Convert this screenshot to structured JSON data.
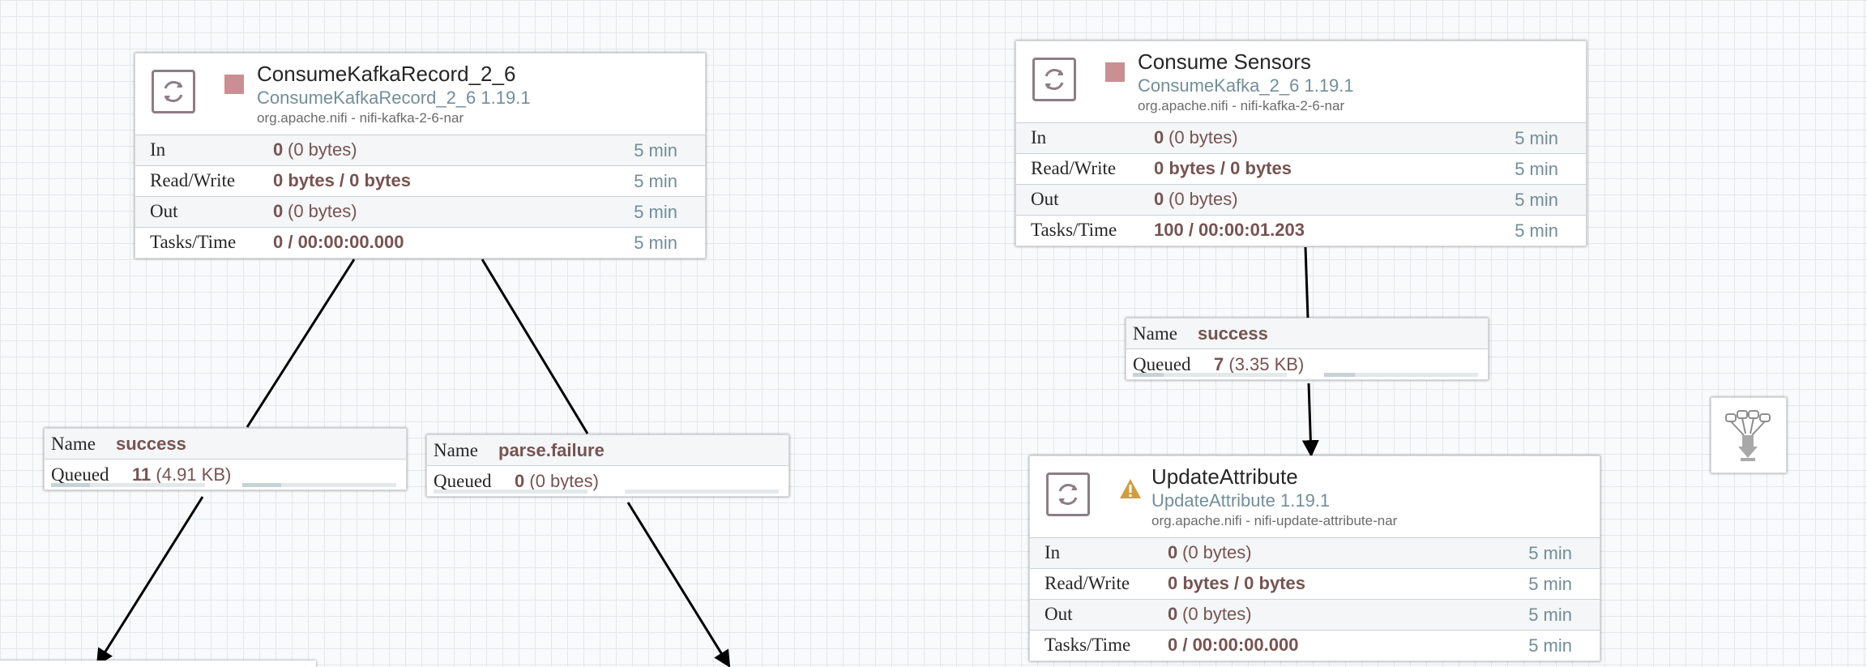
{
  "processors": [
    {
      "name": "ConsumeKafkaRecord_2_6",
      "type": "ConsumeKafkaRecord_2_6 1.19.1",
      "bundle": "org.apache.nifi - nifi-kafka-2-6-nar",
      "run_status": "stopped",
      "stats": {
        "in": {
          "label": "In",
          "count": "0",
          "size": "(0 bytes)",
          "time": "5 min"
        },
        "read_write": {
          "label": "Read/Write",
          "value": "0 bytes / 0 bytes",
          "time": "5 min"
        },
        "out": {
          "label": "Out",
          "count": "0",
          "size": "(0 bytes)",
          "time": "5 min"
        },
        "tasks": {
          "label": "Tasks/Time",
          "value": "0 / 00:00:00.000",
          "time": "5 min"
        }
      }
    },
    {
      "name": "Consume Sensors",
      "type": "ConsumeKafka_2_6 1.19.1",
      "bundle": "org.apache.nifi - nifi-kafka-2-6-nar",
      "run_status": "stopped",
      "stats": {
        "in": {
          "label": "In",
          "count": "0",
          "size": "(0 bytes)",
          "time": "5 min"
        },
        "read_write": {
          "label": "Read/Write",
          "value": "0 bytes / 0 bytes",
          "time": "5 min"
        },
        "out": {
          "label": "Out",
          "count": "0",
          "size": "(0 bytes)",
          "time": "5 min"
        },
        "tasks": {
          "label": "Tasks/Time",
          "value": "100 / 00:00:01.203",
          "time": "5 min"
        }
      }
    },
    {
      "name": "UpdateAttribute",
      "type": "UpdateAttribute 1.19.1",
      "bundle": "org.apache.nifi - nifi-update-attribute-nar",
      "run_status": "invalid",
      "stats": {
        "in": {
          "label": "In",
          "count": "0",
          "size": "(0 bytes)",
          "time": "5 min"
        },
        "read_write": {
          "label": "Read/Write",
          "value": "0 bytes / 0 bytes",
          "time": "5 min"
        },
        "out": {
          "label": "Out",
          "count": "0",
          "size": "(0 bytes)",
          "time": "5 min"
        },
        "tasks": {
          "label": "Tasks/Time",
          "value": "0 / 00:00:00.000",
          "time": "5 min"
        }
      }
    }
  ],
  "connections": [
    {
      "name_label": "Name",
      "name": "success",
      "queued_label": "Queued",
      "count": "11",
      "size": "(4.91 KB)",
      "fill": 0.25
    },
    {
      "name_label": "Name",
      "name": "parse.failure",
      "queued_label": "Queued",
      "count": "0",
      "size": "(0 bytes)",
      "fill": 0
    },
    {
      "name_label": "Name",
      "name": "success",
      "queued_label": "Queued",
      "count": "7",
      "size": "(3.35 KB)",
      "fill": 0.2
    }
  ],
  "funnel": {
    "icon": "funnel-icon"
  },
  "colors": {
    "stopped": "#c98f93",
    "warning": "#d19e3e",
    "accent": "#728e9b",
    "value": "#775351"
  }
}
